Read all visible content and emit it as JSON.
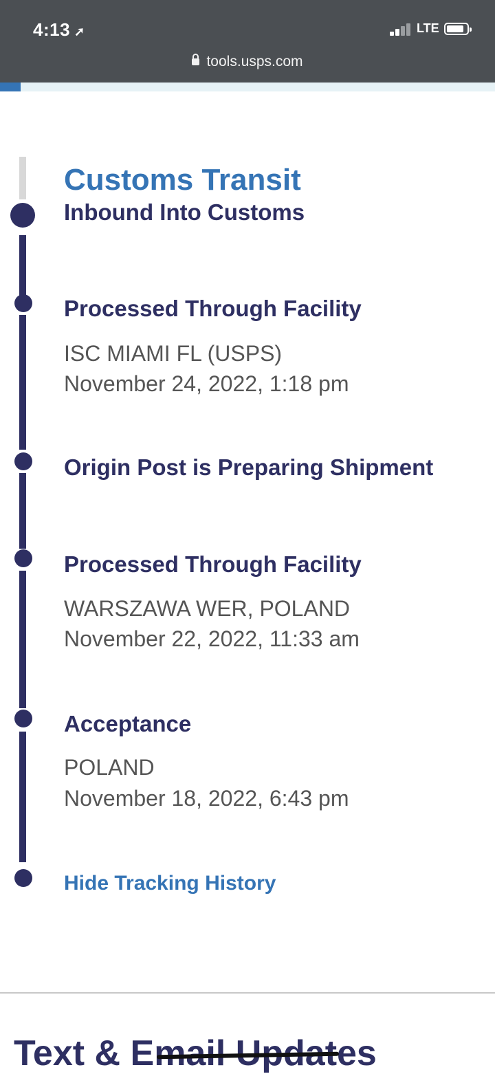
{
  "status_bar": {
    "time": "4:13",
    "network": "LTE"
  },
  "browser": {
    "url": "tools.usps.com"
  },
  "tracking": {
    "status_heading": "Customs Transit",
    "events": [
      {
        "title": "Inbound Into Customs",
        "location": "",
        "datetime": ""
      },
      {
        "title": "Processed Through Facility",
        "location": "ISC MIAMI FL (USPS)",
        "datetime": "November 24, 2022, 1:18 pm"
      },
      {
        "title": "Origin Post is Preparing Shipment",
        "location": "",
        "datetime": ""
      },
      {
        "title": "Processed Through Facility",
        "location": "WARSZAWA WER, POLAND",
        "datetime": "November 22, 2022, 11:33 am"
      },
      {
        "title": "Acceptance",
        "location": "POLAND",
        "datetime": "November 18, 2022, 6:43 pm"
      }
    ],
    "hide_link": "Hide Tracking History"
  },
  "updates_section": {
    "title": "Text & Email Updates"
  },
  "colors": {
    "brand_blue": "#3574b5",
    "navy": "#2e2f62",
    "detail_grey": "#555555"
  }
}
